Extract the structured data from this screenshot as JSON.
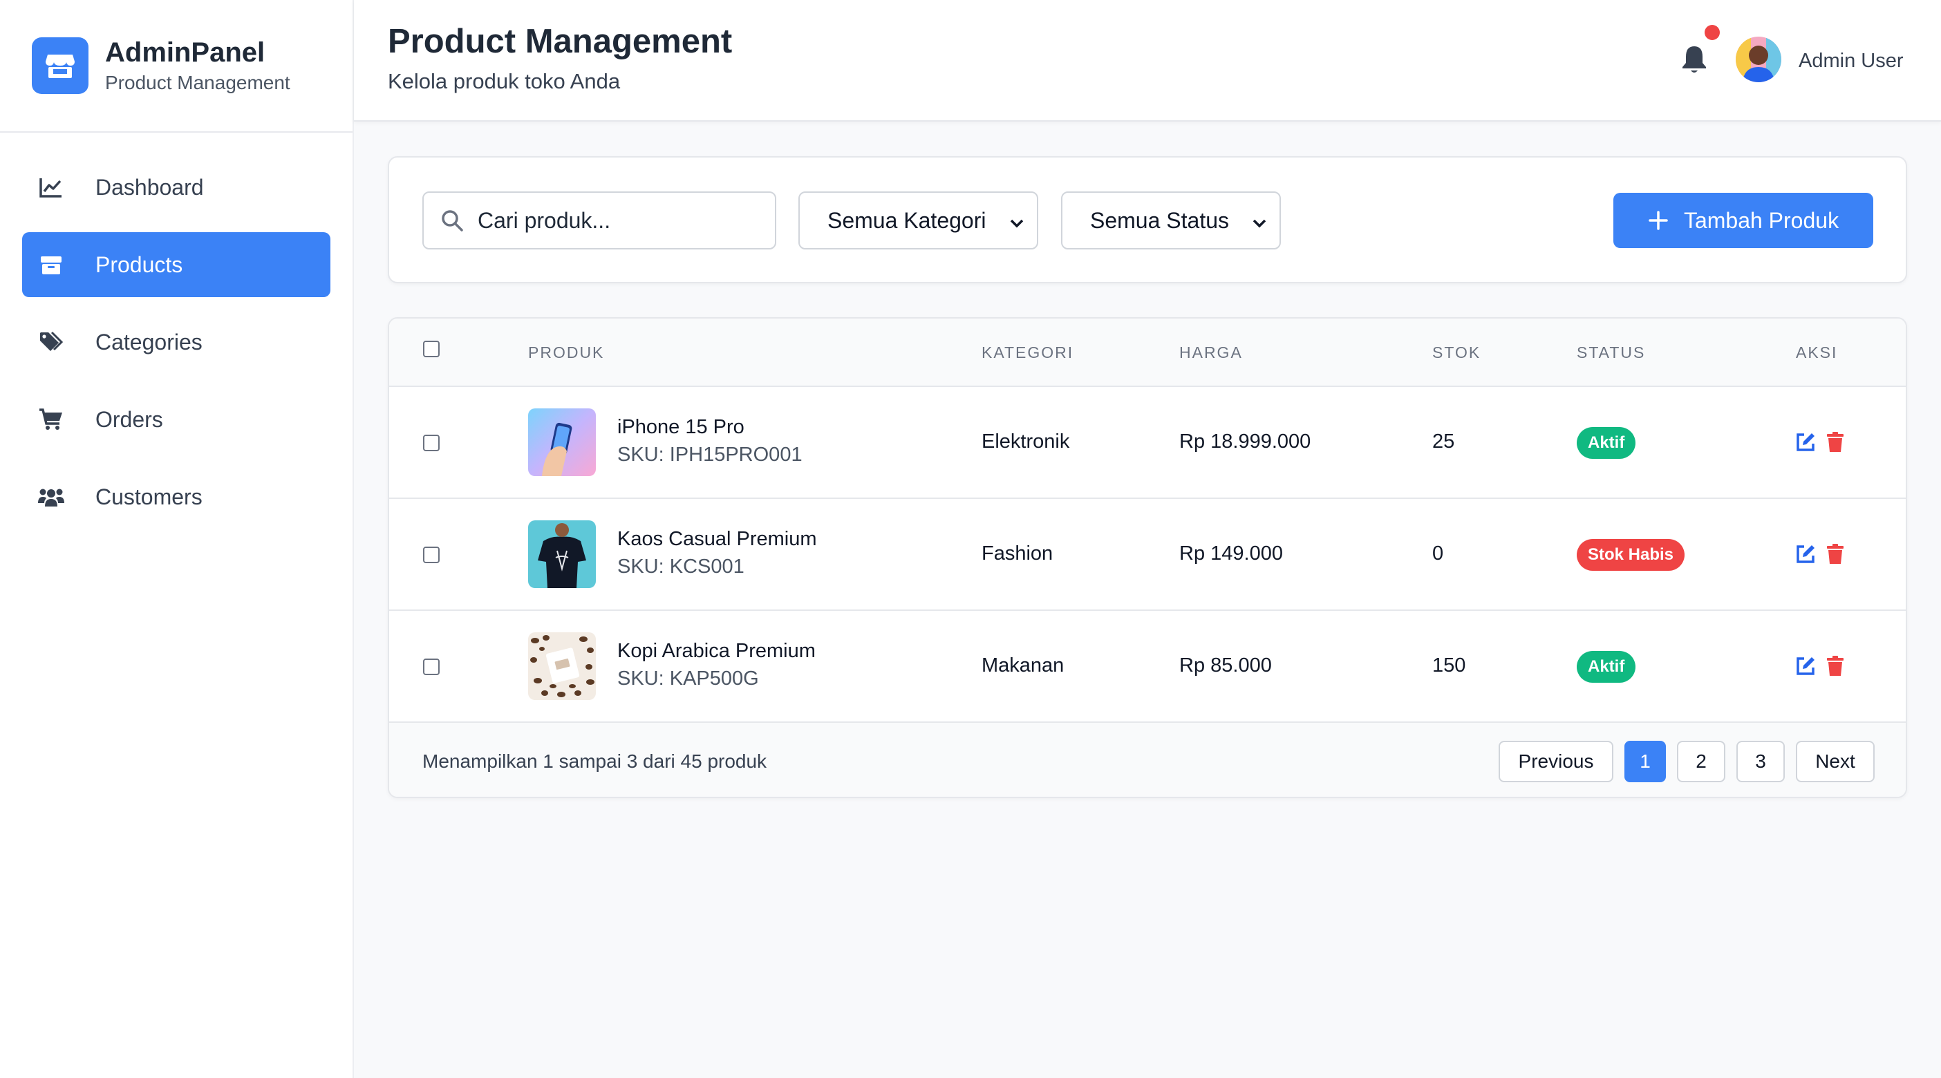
{
  "colors": {
    "primary": "#3b82f6",
    "success": "#10b981",
    "danger": "#ef4444",
    "sidebar_bg": "#ffffff",
    "page_bg": "#f8f9fb"
  },
  "brand": {
    "title": "AdminPanel",
    "subtitle": "Product Management",
    "icon": "store-icon"
  },
  "sidebar": {
    "items": [
      {
        "label": "Dashboard",
        "icon": "chart-line-icon",
        "active": false
      },
      {
        "label": "Products",
        "icon": "box-icon",
        "active": true
      },
      {
        "label": "Categories",
        "icon": "tags-icon",
        "active": false
      },
      {
        "label": "Orders",
        "icon": "cart-icon",
        "active": false
      },
      {
        "label": "Customers",
        "icon": "users-icon",
        "active": false
      }
    ]
  },
  "header": {
    "title": "Product Management",
    "subtitle": "Kelola produk toko Anda",
    "user_name": "Admin User",
    "notification_icon": "bell-icon",
    "has_notification": true
  },
  "filters": {
    "search_placeholder": "Cari produk...",
    "category_selected": "Semua Kategori",
    "status_selected": "Semua Status",
    "add_button_label": "Tambah Produk"
  },
  "table": {
    "headers": {
      "product": "PRODUK",
      "category": "KATEGORI",
      "price": "HARGA",
      "stock": "STOK",
      "status": "STATUS",
      "actions": "AKSI"
    },
    "rows": [
      {
        "name": "iPhone 15 Pro",
        "sku": "SKU: IPH15PRO001",
        "category": "Elektronik",
        "price": "Rp 18.999.000",
        "stock": "25",
        "status": "Aktif",
        "status_type": "success"
      },
      {
        "name": "Kaos Casual Premium",
        "sku": "SKU: KCS001",
        "category": "Fashion",
        "price": "Rp 149.000",
        "stock": "0",
        "status": "Stok Habis",
        "status_type": "danger"
      },
      {
        "name": "Kopi Arabica Premium",
        "sku": "SKU: KAP500G",
        "category": "Makanan",
        "price": "Rp 85.000",
        "stock": "150",
        "status": "Aktif",
        "status_type": "success"
      }
    ]
  },
  "pagination": {
    "summary": "Menampilkan 1 sampai 3 dari 45 produk",
    "previous": "Previous",
    "next": "Next",
    "pages": [
      "1",
      "2",
      "3"
    ],
    "current_page": "1"
  }
}
